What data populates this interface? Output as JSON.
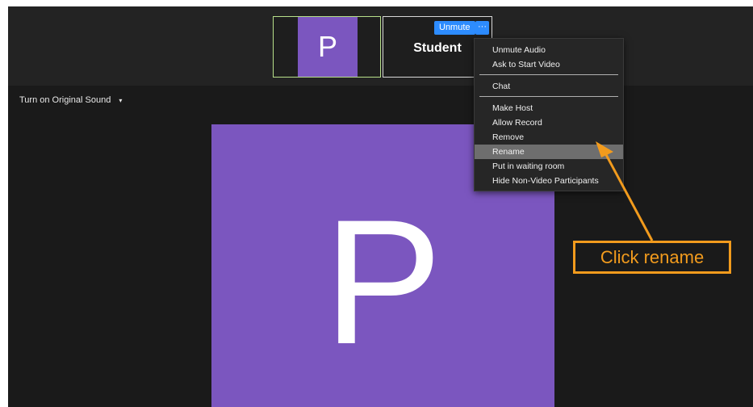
{
  "participants": {
    "self": {
      "initial": "P"
    },
    "student": {
      "name": "Student",
      "unmute_label": "Unmute",
      "more_label": "···"
    }
  },
  "toolbar": {
    "original_sound_label": "Turn on Original Sound",
    "caret": "▾"
  },
  "main_video": {
    "initial": "P",
    "color": "#7b56bf"
  },
  "menu": {
    "items": [
      {
        "label": "Unmute Audio"
      },
      {
        "label": "Ask to Start Video"
      },
      {
        "label": "Chat"
      },
      {
        "label": "Make Host"
      },
      {
        "label": "Allow Record"
      },
      {
        "label": "Remove"
      },
      {
        "label": "Rename",
        "highlighted": true
      },
      {
        "label": "Put in waiting room"
      },
      {
        "label": "Hide Non-Video Participants"
      }
    ]
  },
  "annotation": {
    "text": "Click rename",
    "color": "#f29b1d"
  },
  "colors": {
    "accent": "#2d8cff",
    "avatar": "#7b56bf",
    "self_border": "#b8e08a"
  }
}
